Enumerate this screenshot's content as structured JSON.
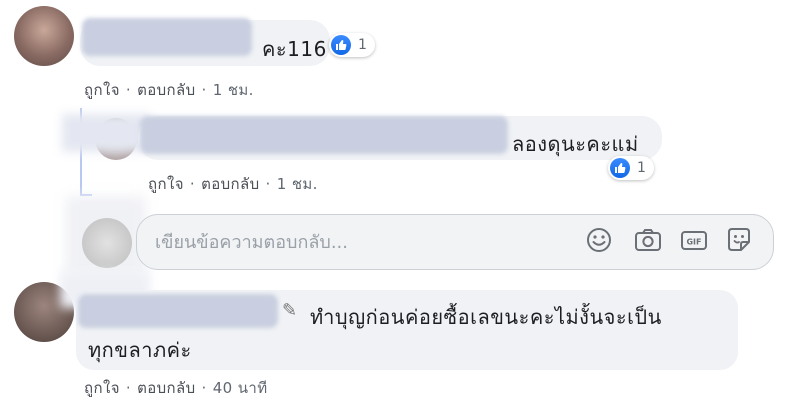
{
  "comments": [
    {
      "text": "คะ116",
      "reaction_count": "1",
      "like_label": "ถูกใจ",
      "reply_label": "ตอบกลับ",
      "time": "1 ชม."
    },
    {
      "text": "ลองดุนะคะแม่",
      "reaction_count": "1",
      "like_label": "ถูกใจ",
      "reply_label": "ตอบกลับ",
      "time": "1 ชม."
    },
    {
      "text_line1": "ทำบุญก่อนค่อยซื้อเลขนะคะไม่งั้นจะเป็น",
      "text_line2": "ทุกขลาภค่ะ",
      "like_label": "ถูกใจ",
      "reply_label": "ตอบกลับ",
      "time": "40 นาที"
    }
  ],
  "reply_composer": {
    "placeholder": "เขียนข้อความตอบกลับ...",
    "icons": [
      "emoji-icon",
      "camera-icon",
      "gif-icon",
      "sticker-icon"
    ]
  },
  "colors": {
    "like_blue": "#1877f2",
    "bubble_bg": "#f0f2f5",
    "thread_line": "#b9c8f0"
  }
}
